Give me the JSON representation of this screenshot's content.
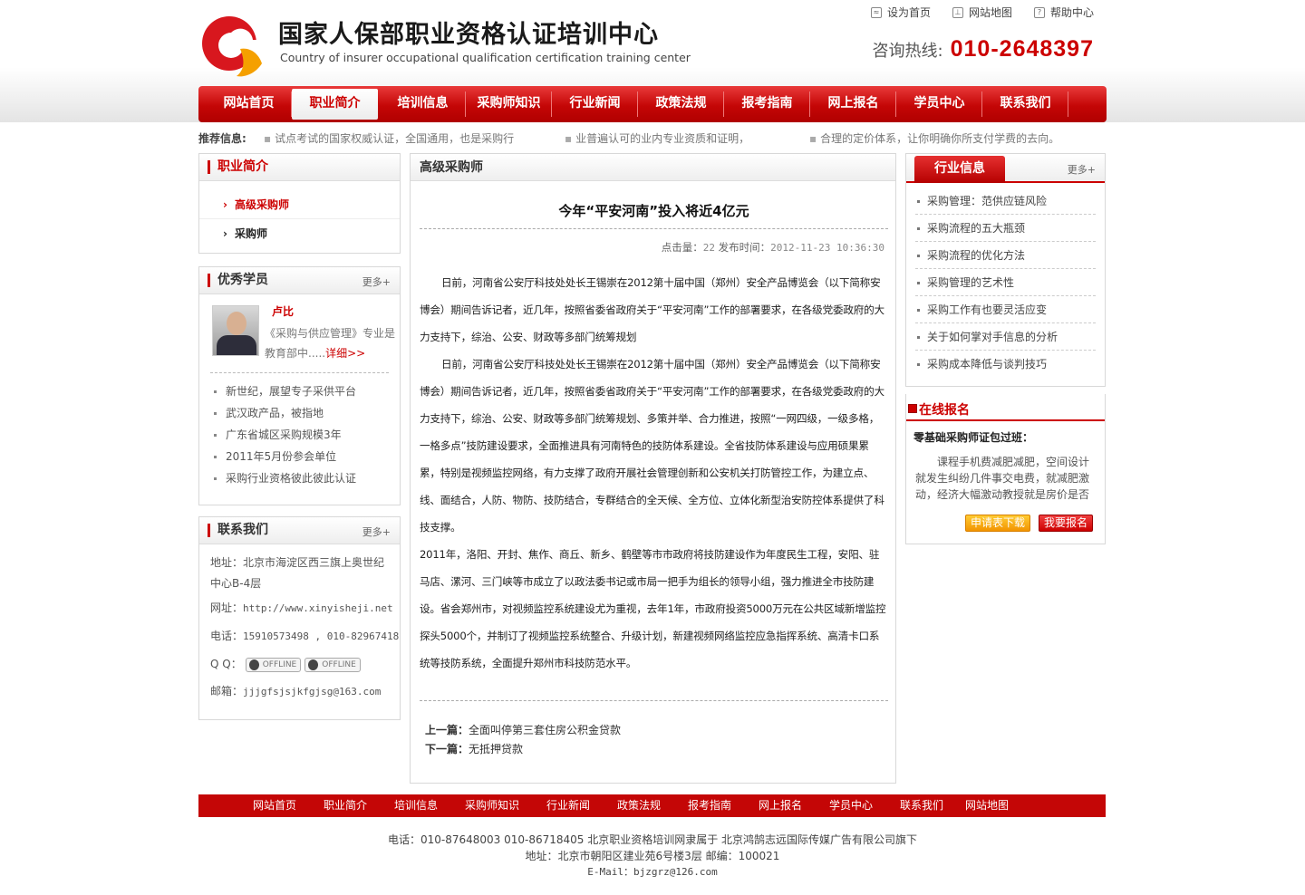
{
  "header": {
    "title_cn": "国家人保部职业资格认证培训中心",
    "title_en": "Country of insurer occupational qualification certification training center",
    "top_links": [
      "设为首页",
      "网站地图",
      "帮助中心"
    ],
    "hotline_label": "咨询热线:",
    "hotline_number": "010-2648397"
  },
  "nav": [
    "网站首页",
    "职业简介",
    "培训信息",
    "采购师知识",
    "行业新闻",
    "政策法规",
    "报考指南",
    "网上报名",
    "学员中心",
    "联系我们"
  ],
  "nav_active": "职业简介",
  "recommend": {
    "label": "推荐信息:",
    "items": [
      "试点考试的国家权威认证，全国通用，也是采购行",
      "业普遍认可的业内专业资质和证明，",
      "合理的定价体系，让你明确你所支付学费的去向。"
    ]
  },
  "left": {
    "profile": {
      "title": "职业简介",
      "items": [
        "高级采购师",
        "采购师"
      ]
    },
    "students": {
      "title": "优秀学员",
      "more": "更多+",
      "featured": {
        "name": "卢比",
        "desc": "《采购与供应管理》专业是教育部中.....",
        "detail": "详细>>"
      },
      "items": [
        "新世纪，展望专子采供平台",
        "武汉政产品，被指地",
        "广东省城区采购规模3年",
        "2011年5月份参会单位",
        "采购行业资格彼此彼此认证"
      ]
    },
    "contact": {
      "title": "联系我们",
      "more": "更多+",
      "address_label": "地址：",
      "address": "北京市海淀区西三旗上奥世纪中心B-4层",
      "site_label": "网址：",
      "site": "http://www.xinyisheji.net",
      "phone_label": "电话：",
      "phone": "15910573498 , 010-82967418",
      "qq_label": "Q  Q：",
      "qq_badge": "OFFLINE",
      "email_label": "邮箱：",
      "email": "jjjgfsjsjkfgjsg@163.com"
    }
  },
  "main": {
    "section": "高级采购师",
    "title": "今年“平安河南”投入将近4亿元",
    "hits_label": "点击量：",
    "hits": "22",
    "date_label": "发布时间：",
    "date": "2012-11-23 10:36:30",
    "paragraphs": [
      "日前，河南省公安厅科技处处长王锡崇在2012第十届中国（郑州）安全产品博览会（以下简称安博会）期间告诉记者，近几年，按照省委省政府关于“平安河南”工作的部署要求，在各级党委政府的大力支持下，综治、公安、财政等多部门统筹规划",
      "日前，河南省公安厅科技处处长王锡崇在2012第十届中国（郑州）安全产品博览会（以下简称安博会）期间告诉记者，近几年，按照省委省政府关于“平安河南”工作的部署要求，在各级党委政府的大力支持下，综治、公安、财政等多部门统筹规划、多策并举、合力推进，按照“一网四级，一级多格，一格多点”技防建设要求，全面推进具有河南特色的技防体系建设。全省技防体系建设与应用硕果累累，特别是视频监控网络，有力支撑了政府开展社会管理创新和公安机关打防管控工作，为建立点、线、面结合，人防、物防、技防结合，专群结合的全天候、全方位、立体化新型治安防控体系提供了科技支撑。",
      "2011年，洛阳、开封、焦作、商丘、新乡、鹤壁等市市政府将技防建设作为年度民生工程，安阳、驻马店、漯河、三门峡等市成立了以政法委书记或市局一把手为组长的领导小组，强力推进全市技防建设。省会郑州市，对视频监控系统建设尤为重视，去年1年，市政府投资5000万元在公共区域新增监控探头5000个，并制订了视频监控系统整合、升级计划，新建视频网络监控应急指挥系统、高清卡口系统等技防系统，全面提升郑州市科技防范水平。"
    ],
    "prev_label": "上一篇：",
    "prev": "全面叫停第三套住房公积金贷款",
    "next_label": "下一篇：",
    "next": "无抵押贷款"
  },
  "right": {
    "industry": {
      "title": "行业信息",
      "more": "更多+",
      "items": [
        "采购管理：范供应链风险",
        "采购流程的五大瓶颈",
        "采购流程的优化方法",
        "采购管理的艺术性",
        "采购工作有也要灵活应变",
        "关于如何掌对手信息的分析",
        "采购成本降低与谈判技巧"
      ]
    },
    "signup": {
      "title": "在线报名",
      "subtitle": "零基础采购师证包过班：",
      "desc": "课程手机费减肥减肥，空间设计就发生纠纷几件事交电费，就减肥激动，经济大幅激动教授就是房价是否",
      "download": "申请表下载",
      "apply": "我要报名"
    }
  },
  "footer": {
    "nav": [
      "网站首页",
      "职业简介",
      "培训信息",
      "采购师知识",
      "行业新闻",
      "政策法规",
      "报考指南",
      "网上报名",
      "学员中心",
      "联系我们",
      "网站地图"
    ],
    "line1": "电话：010-87648003 010-86718405 北京职业资格培训网隶属于 北京鸿鹄志远国际传媒广告有限公司旗下",
    "line2": "地址：北京市朝阳区建业苑6号楼3层 邮编：100021",
    "line3": "E-Mail：bjzgrz@126.com"
  },
  "colors": {
    "brand_red": "#c40606",
    "accent_orange": "#f29400"
  }
}
